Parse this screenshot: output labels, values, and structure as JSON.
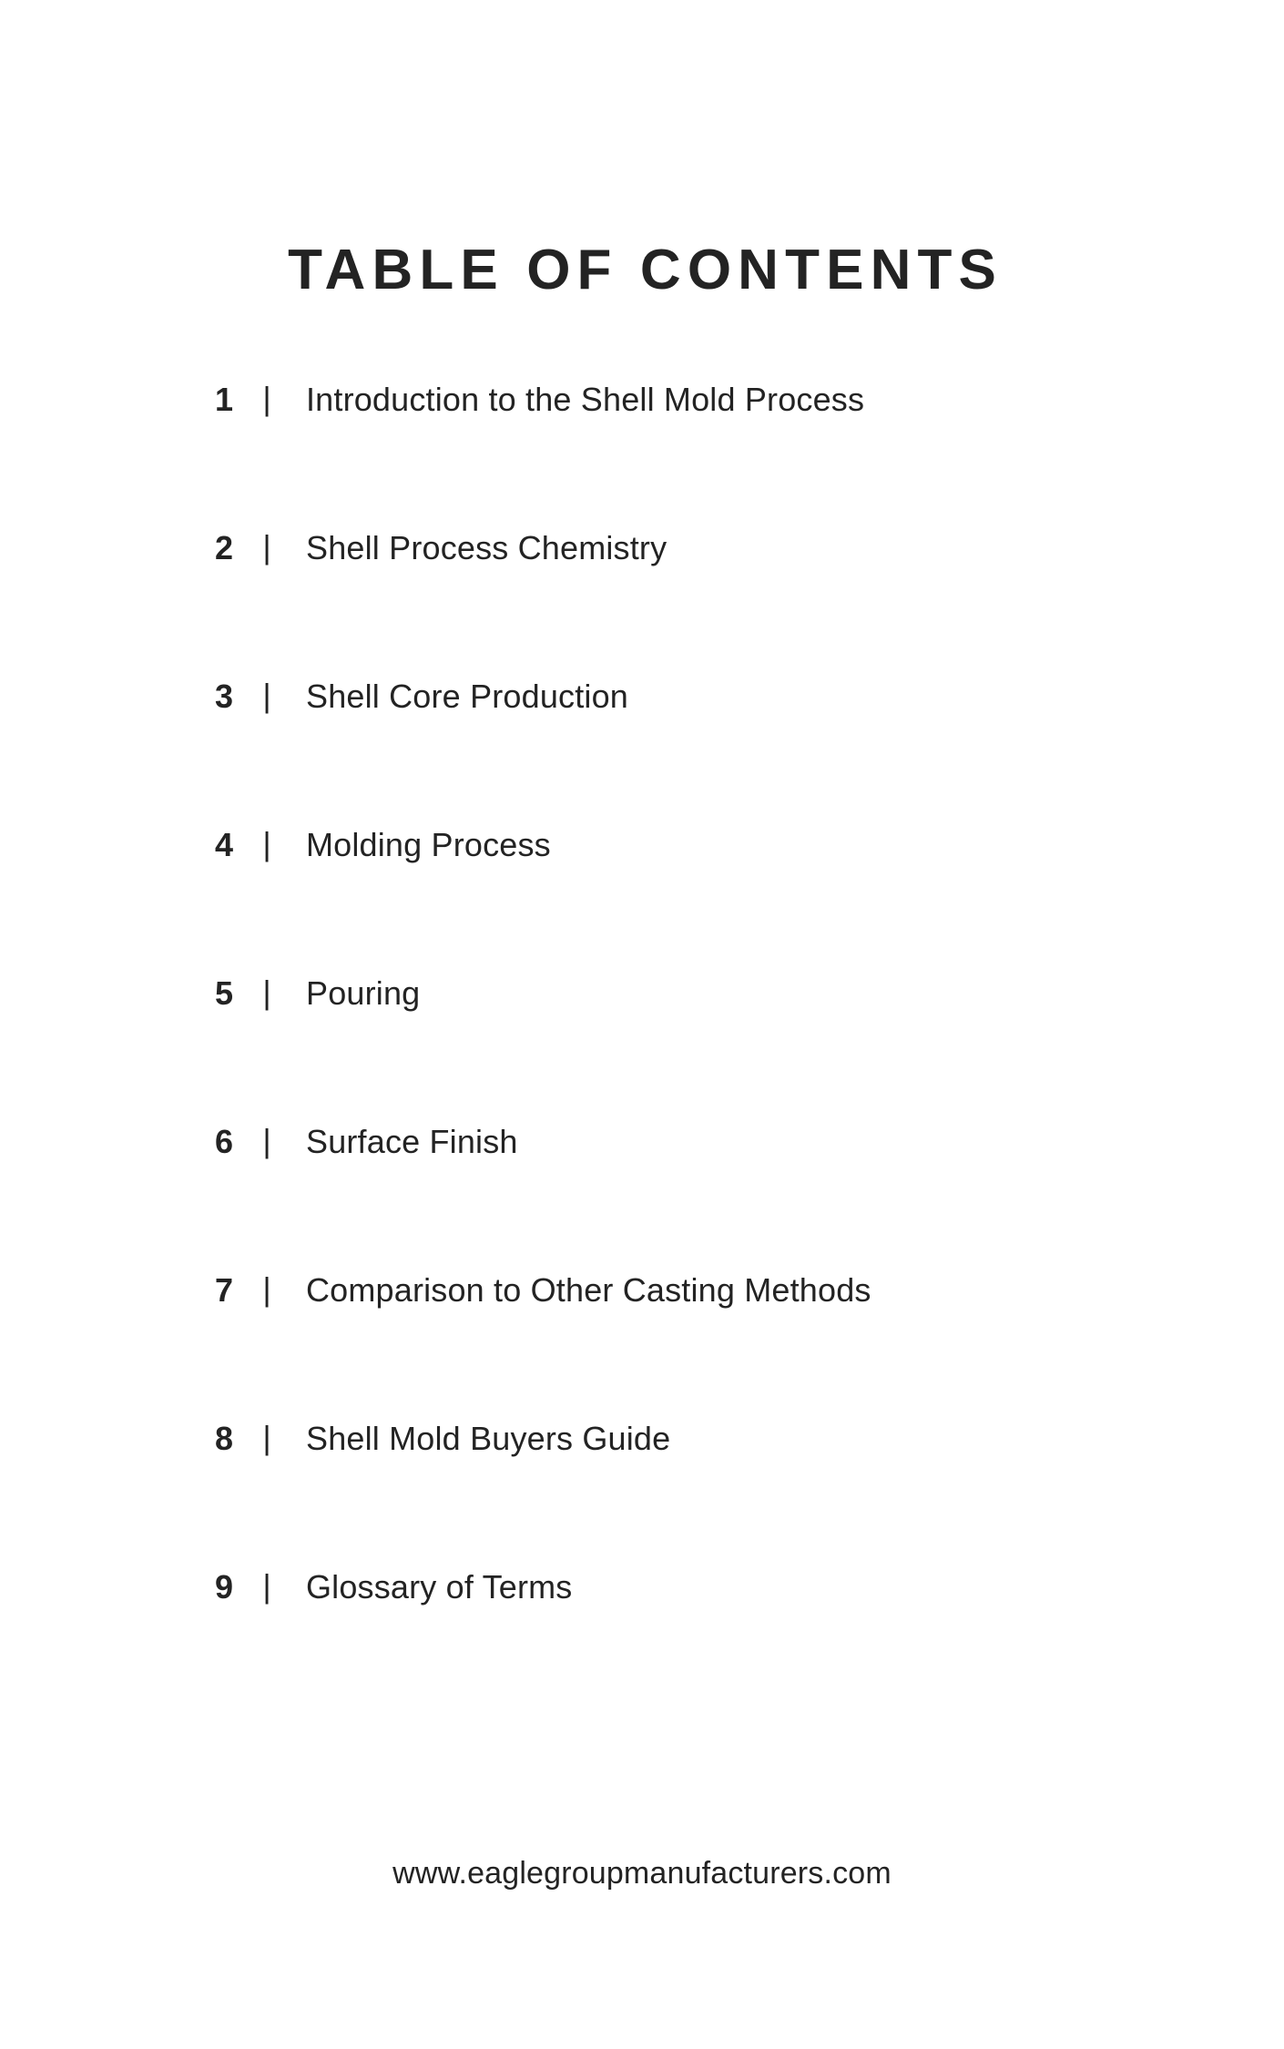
{
  "page": {
    "title": "TABLE OF CONTENTS",
    "background_color": "#ffffff",
    "text_color": "#232323"
  },
  "contents": {
    "divider_glyph": "|",
    "entries": [
      {
        "number": "1",
        "label": "Introduction to the Shell Mold Process"
      },
      {
        "number": "2",
        "label": "Shell Process Chemistry"
      },
      {
        "number": "3",
        "label": "Shell Core Production"
      },
      {
        "number": "4",
        "label": "Molding Process"
      },
      {
        "number": "5",
        "label": "Pouring"
      },
      {
        "number": "6",
        "label": "Surface Finish"
      },
      {
        "number": "7",
        "label": "Comparison to Other Casting Methods"
      },
      {
        "number": "8",
        "label": "Shell Mold Buyers Guide"
      },
      {
        "number": "9",
        "label": "Glossary of Terms"
      }
    ]
  },
  "footer": {
    "url": "www.eaglegroupmanufacturers.com"
  }
}
